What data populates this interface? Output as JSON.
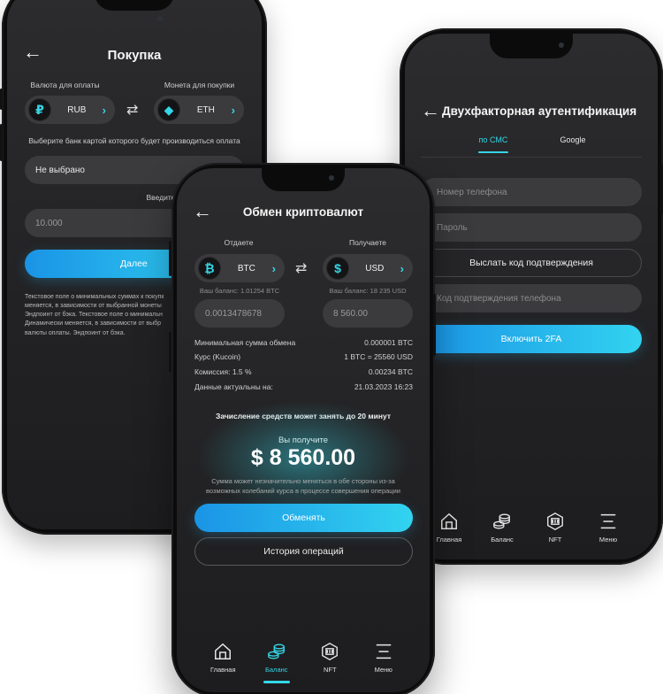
{
  "purchase": {
    "title": "Покупка",
    "pay_currency_label": "Валюта для оплаты",
    "buy_coin_label": "Монета для покупки",
    "pay_currency": "RUB",
    "buy_coin": "ETH",
    "bank_label": "Выберите банк картой которого будет производиться оплата",
    "bank_value": "Не выбрано",
    "amount_label": "Введите сумму покупки",
    "amount_value": "10.000",
    "next_button": "Далее",
    "description_lines": [
      "Текстовое поле о минимальных суммах к покупк",
      "меняется, в зависимости от выбранной монеты",
      "Эндпоинт от бэка. Текстовое поле о минимальн",
      "Динамически меняется, в зависимости от выбр",
      "валюты оплаты. Эндпоинт от бэка."
    ]
  },
  "twofa": {
    "title": "Двухфакторная аутентификация",
    "tabs": [
      {
        "label": "по СМС",
        "active": true
      },
      {
        "label": "Google",
        "active": false
      }
    ],
    "phone_placeholder": "Номер телефона",
    "password_placeholder": "Пароль",
    "send_code_button": "Выслать код подтверждения",
    "code_placeholder": "Код подтверждения телефона",
    "enable_button": "Включить 2FA",
    "nav": [
      {
        "label": "Главная",
        "icon": "home-icon"
      },
      {
        "label": "Баланс",
        "icon": "coins-icon"
      },
      {
        "label": "NFT",
        "icon": "nft-icon"
      },
      {
        "label": "Меню",
        "icon": "menu-icon"
      }
    ]
  },
  "exchange": {
    "title": "Обмен криптовалют",
    "give_label": "Отдаете",
    "get_label": "Получаете",
    "give_coin": "BTC",
    "get_coin": "USD",
    "give_balance": "Ваш баланс: 1.01254 BTC",
    "get_balance": "Ваш баланс: 18 235 USD",
    "give_amount": "0.0013478678",
    "get_amount": "8 560.00",
    "info": [
      {
        "label": "Минимальная сумма обмена",
        "value": "0.000001 BTC"
      },
      {
        "label": "Курс (Kucoin)",
        "value": "1 BTC = 25560 USD"
      },
      {
        "label": "Комиссия: 1.5 %",
        "value": "0.00234 BTC"
      },
      {
        "label": "Данные актуальны на:",
        "value": "21.03.2023 16:23"
      }
    ],
    "credit_notice": "Зачисление средств может занять до 20 минут",
    "receive_label": "Вы получите",
    "receive_amount": "$ 8 560.00",
    "disclaimer_lines": [
      "Сумма может незначительно меняться в обе стороны из-за",
      "возможных колебаний курса в процессе совершения операции"
    ],
    "exchange_button": "Обменять",
    "history_button": "История операций",
    "nav": [
      {
        "label": "Главная",
        "icon": "home-icon"
      },
      {
        "label": "Баланс",
        "icon": "coins-icon",
        "active": true
      },
      {
        "label": "NFT",
        "icon": "nft-icon"
      },
      {
        "label": "Меню",
        "icon": "menu-icon"
      }
    ]
  },
  "colors": {
    "accent": "#35d6e6",
    "button_gradient_start": "#1a94e6",
    "button_gradient_end": "#32d3f0",
    "screen_bg": "#2c2c2e",
    "field_bg": "#3b3b3e"
  }
}
